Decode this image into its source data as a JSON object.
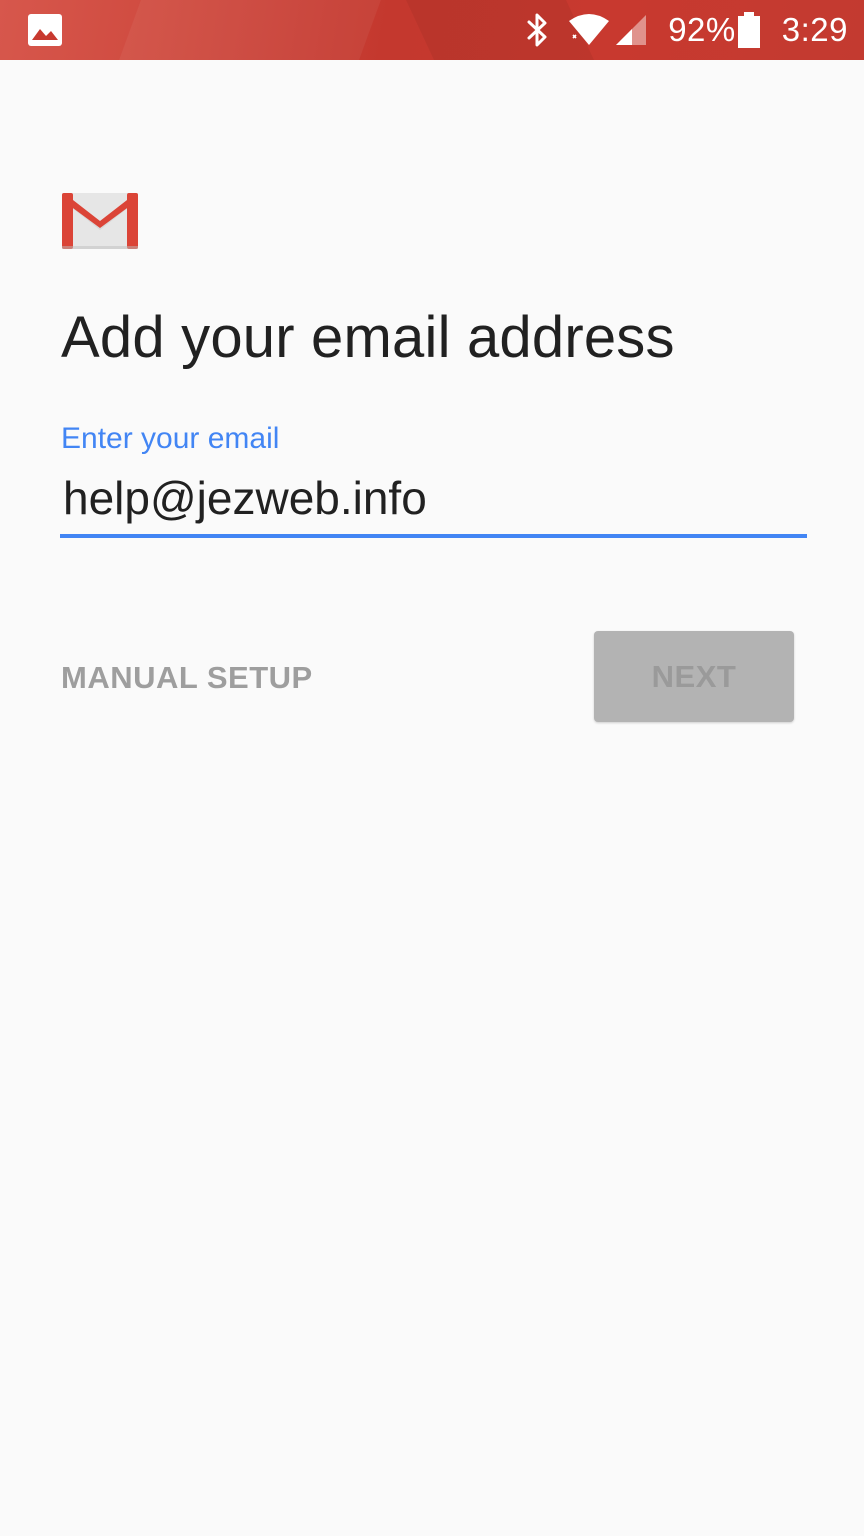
{
  "status_bar": {
    "battery_percent": "92%",
    "battery_level": 0.92,
    "time": "3:29",
    "icons": [
      "image-icon",
      "bluetooth-icon",
      "wifi-icon",
      "cell-signal-icon",
      "battery-icon"
    ]
  },
  "app": {
    "logo": "gmail-logo-icon"
  },
  "main": {
    "title": "Add your email address",
    "email_label": "Enter your email",
    "email_value": "help@jezweb.info"
  },
  "actions": {
    "manual_setup_label": "MANUAL SETUP",
    "next_label": "NEXT"
  },
  "colors": {
    "status_bar": "#c8392f",
    "accent": "#4285f4",
    "gmail_red": "#db4437",
    "disabled_button": "#b3b3b3"
  }
}
